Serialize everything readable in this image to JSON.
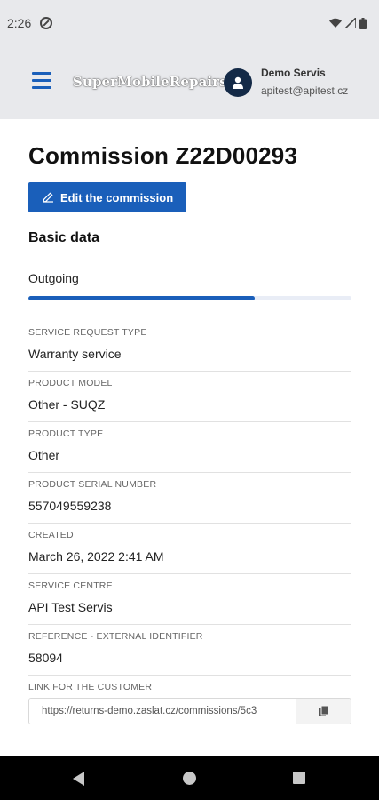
{
  "status_bar": {
    "time": "2:26"
  },
  "header": {
    "brand": "SuperMobileRepairs",
    "user_name": "Demo Servis",
    "user_email": "apitest@apitest.cz"
  },
  "page": {
    "title": "Commission Z22D00293",
    "edit_button": "Edit the commission",
    "section_title": "Basic data",
    "status": "Outgoing",
    "progress_fraction": 0.7
  },
  "fields": [
    {
      "label": "SERVICE REQUEST TYPE",
      "value": "Warranty service"
    },
    {
      "label": "PRODUCT MODEL",
      "value": "Other - SUQZ"
    },
    {
      "label": "PRODUCT TYPE",
      "value": "Other"
    },
    {
      "label": "PRODUCT SERIAL NUMBER",
      "value": "557049559238"
    },
    {
      "label": "CREATED",
      "value": "March 26, 2022 2:41 AM"
    },
    {
      "label": "SERVICE CENTRE",
      "value": "API Test Servis"
    },
    {
      "label": "REFERENCE - EXTERNAL IDENTIFIER",
      "value": "58094"
    }
  ],
  "customer_link": {
    "label": "LINK FOR THE CUSTOMER",
    "value": "https://returns-demo.zaslat.cz/commissions/5c3"
  },
  "colors": {
    "accent": "#1a5fba",
    "header_bg": "#e8e9ec"
  },
  "icons": [
    "dnd-icon",
    "wifi-icon",
    "signal-icon",
    "battery-icon",
    "menu-icon",
    "user-icon",
    "pencil-icon",
    "copy-icon",
    "back-icon",
    "home-icon",
    "recents-icon"
  ]
}
